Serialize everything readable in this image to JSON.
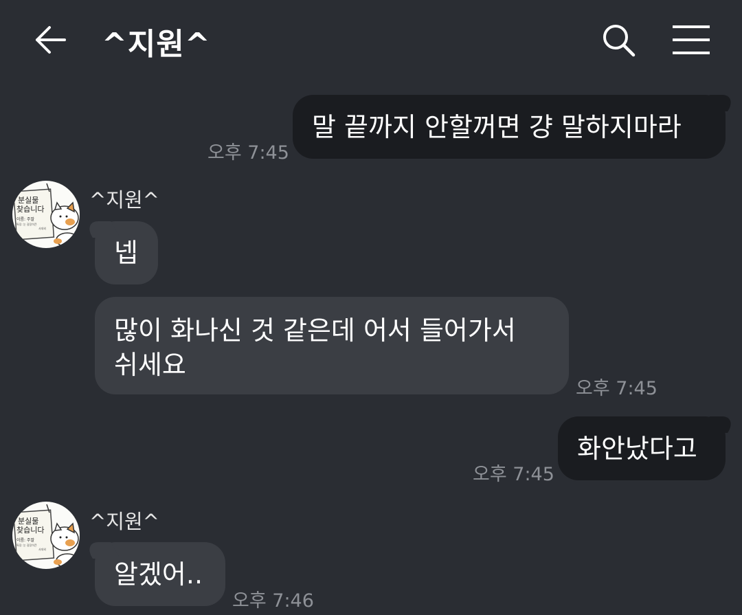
{
  "header": {
    "title": "^지원^",
    "back_icon": "arrow-left-icon",
    "search_icon": "search-icon",
    "menu_icon": "hamburger-menu-icon"
  },
  "contact": {
    "name": "^지원^",
    "avatar_text": [
      "분실물",
      "찾습니다",
      "이름: 주말",
      "특징: 눈 굉장히큰",
      "사대외"
    ]
  },
  "messages": [
    {
      "direction": "outgoing",
      "text": "말 끝까지 안할꺼면 걍 말하지마라",
      "time": "오후 7:45"
    },
    {
      "direction": "incoming",
      "text": "넵"
    },
    {
      "direction": "incoming",
      "lines": [
        "많이 화나신 것 같은데 어서 들어가서",
        "쉬세요"
      ],
      "time": "오후 7:45"
    },
    {
      "direction": "outgoing",
      "text": "화안났다고",
      "time": "오후 7:45"
    },
    {
      "direction": "incoming",
      "text": "알겠어..",
      "time": "오후 7:46"
    }
  ],
  "colors": {
    "background": "#2a2d33",
    "outgoing_bubble": "#1a1c20",
    "incoming_bubble": "#3b3e44",
    "timestamp": "#8e9197"
  }
}
